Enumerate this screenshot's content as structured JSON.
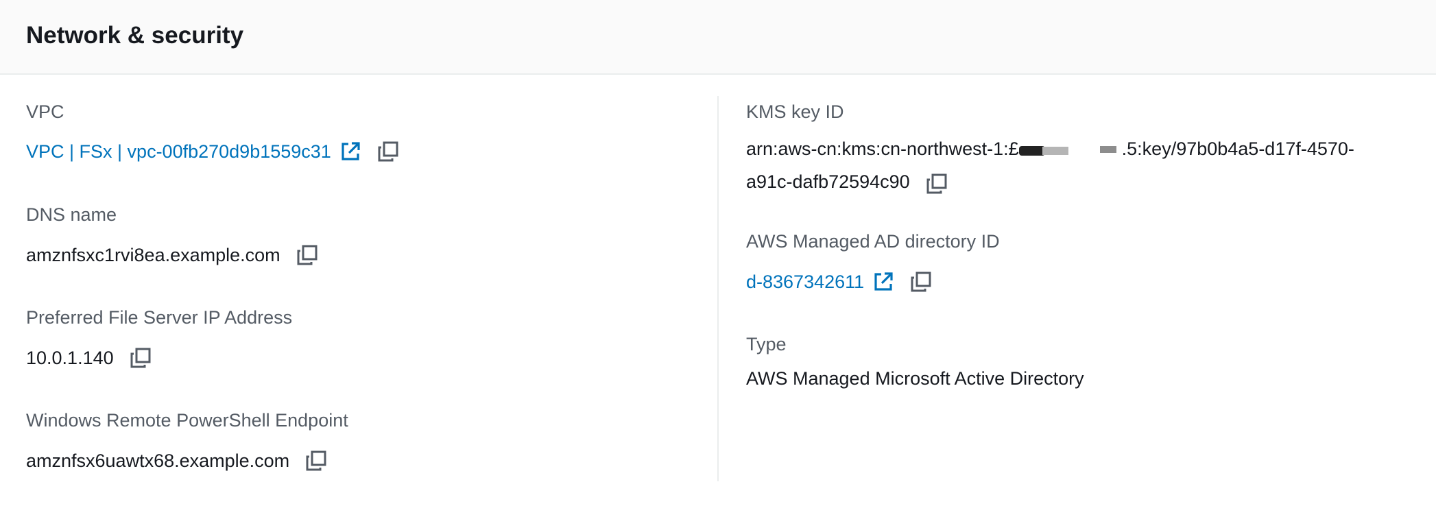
{
  "panel": {
    "title": "Network & security"
  },
  "left_column": {
    "vpc": {
      "label": "VPC",
      "value": "VPC | FSx | vpc-00fb270d9b1559c31"
    },
    "dns_name": {
      "label": "DNS name",
      "value": "amznfsxc1rvi8ea.example.com"
    },
    "preferred_ip": {
      "label": "Preferred File Server IP Address",
      "value": "10.0.1.140"
    },
    "powershell_endpoint": {
      "label": "Windows Remote PowerShell Endpoint",
      "value": "amznfsx6uawtx68.example.com"
    }
  },
  "right_column": {
    "kms": {
      "label": "KMS key ID",
      "value_prefix": "arn:aws-cn:kms:cn-northwest-1:£",
      "value_middle": ".",
      "value_suffix": "5:key/97b0b4a5-d17f-4570-",
      "value_line2": "a91c-dafb72594c90"
    },
    "ad_directory": {
      "label": "AWS Managed AD directory ID",
      "value": "d-8367342611"
    },
    "type": {
      "label": "Type",
      "value": "AWS Managed Microsoft Active Directory"
    }
  },
  "icons": {
    "external_link": "external-link-icon",
    "copy": "copy-icon"
  },
  "colors": {
    "link": "#0073bb",
    "label": "#545b64",
    "text": "#16191f",
    "header_bg": "#fafafa"
  }
}
